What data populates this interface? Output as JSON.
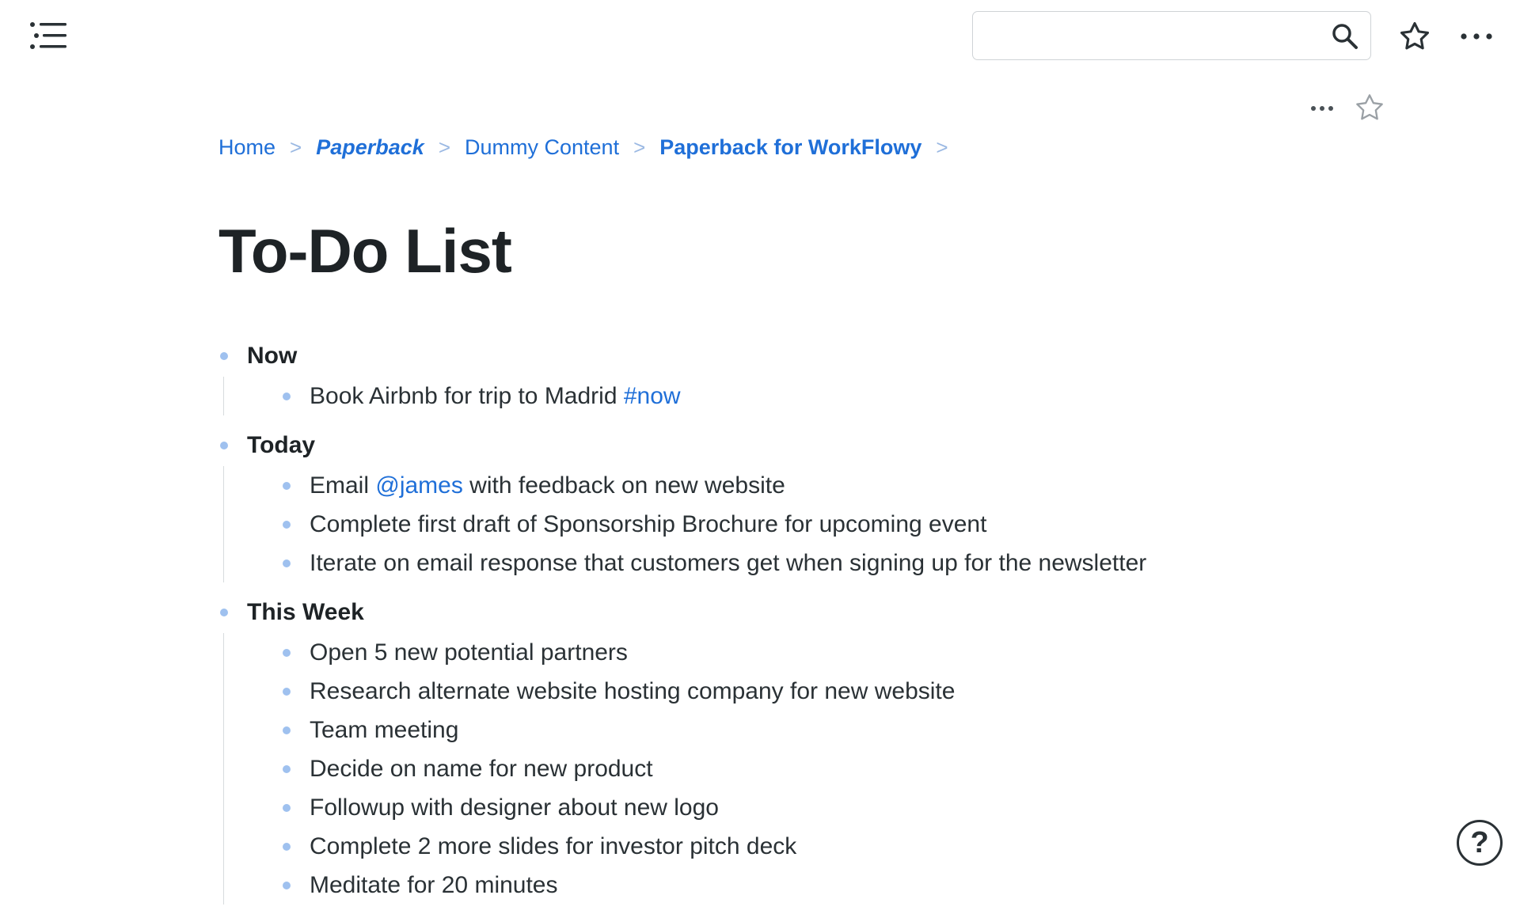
{
  "colors": {
    "link": "#1f6fd8",
    "bullet": "#9fc1ef",
    "text": "#2a3135",
    "title": "#1e2326"
  },
  "toolbar": {
    "search_placeholder": "",
    "search_value": ""
  },
  "breadcrumb": [
    {
      "label": "Home"
    },
    {
      "label": "Paperback"
    },
    {
      "label": "Dummy Content"
    },
    {
      "label": "Paperback for WorkFlowy"
    }
  ],
  "breadcrumb_sep": ">",
  "page": {
    "title": "To-Do List"
  },
  "outline": {
    "now": {
      "title": "Now",
      "items": [
        {
          "before": "Book Airbnb for trip to Madrid ",
          "tag": "#now",
          "after": ""
        }
      ]
    },
    "today": {
      "title": "Today",
      "items": [
        {
          "before": "Email ",
          "tag": "@james",
          "after": " with feedback on new website"
        },
        {
          "text": "Complete first draft of Sponsorship Brochure for upcoming event"
        },
        {
          "text": "Iterate on email response that customers get when signing up for the newsletter"
        }
      ]
    },
    "this_week": {
      "title": "This Week",
      "items": [
        {
          "text": "Open 5 new potential partners"
        },
        {
          "text": "Research alternate website hosting company for new website"
        },
        {
          "text": "Team meeting"
        },
        {
          "text": "Decide on name for new product"
        },
        {
          "text": "Followup with designer about new logo"
        },
        {
          "text": "Complete 2 more slides for investor pitch deck"
        },
        {
          "text": "Meditate for 20 minutes"
        }
      ]
    }
  },
  "help": {
    "label": "?"
  }
}
